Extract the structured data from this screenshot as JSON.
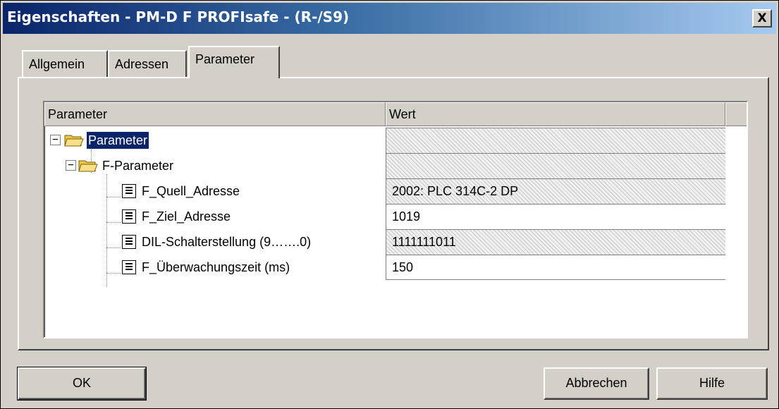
{
  "window": {
    "title": "Eigenschaften - PM-D F PROFIsafe - (R-/S9)",
    "close_symbol": "X"
  },
  "tabs": [
    {
      "label": "Allgemein",
      "active": false
    },
    {
      "label": "Adressen",
      "active": false
    },
    {
      "label": "Parameter",
      "active": true
    }
  ],
  "grid": {
    "headers": [
      "Parameter",
      "Wert"
    ],
    "rows": [
      {
        "name": "Parameter",
        "value": "",
        "type": "folder",
        "level": 0,
        "selected": true,
        "readonly": true
      },
      {
        "name": "F-Parameter",
        "value": "",
        "type": "folder",
        "level": 1,
        "selected": false,
        "readonly": true
      },
      {
        "name": "F_Quell_Adresse",
        "value": "2002: PLC 314C-2 DP",
        "type": "param",
        "level": 2,
        "selected": false,
        "readonly": true
      },
      {
        "name": "F_Ziel_Adresse",
        "value": "1019",
        "type": "param",
        "level": 2,
        "selected": false,
        "readonly": false
      },
      {
        "name": "DIL-Schalterstellung (9…….0)",
        "value": "1111111011",
        "type": "param",
        "level": 2,
        "selected": false,
        "readonly": true
      },
      {
        "name": "F_Überwachungszeit (ms)",
        "value": "150",
        "type": "param",
        "level": 2,
        "selected": false,
        "readonly": false
      }
    ]
  },
  "buttons": {
    "ok": "OK",
    "cancel": "Abbrechen",
    "help": "Hilfe"
  },
  "colors": {
    "title_bar_start": "#0a246a",
    "title_bar_end": "#a6caf0",
    "selection": "#0a246a",
    "face": "#d4d0c8"
  },
  "icons": {
    "folder": "open-folder-icon",
    "parameter": "parameter-document-icon",
    "expand": "minus-expander-icon"
  }
}
